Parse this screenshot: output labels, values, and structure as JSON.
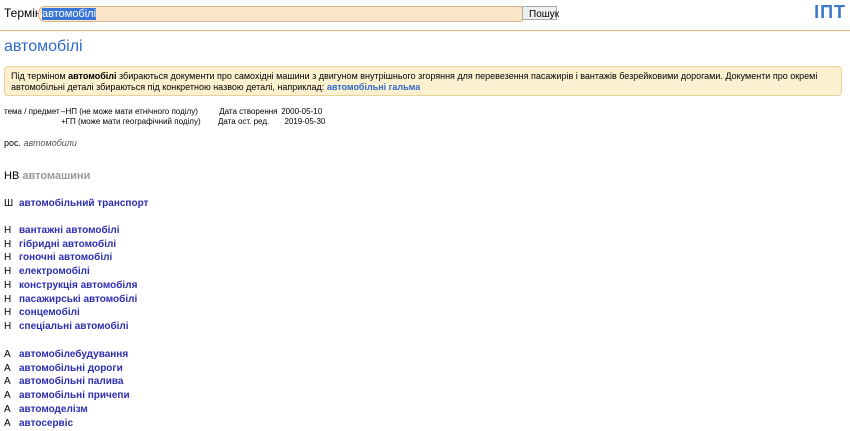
{
  "topbar": {
    "term_label": "Термін:",
    "term_value": "автомобілі",
    "search_button": "Пошук",
    "logo": "ІПТ"
  },
  "title": "автомобілі",
  "note": {
    "prefix": "Під терміном ",
    "term": "автомобілі",
    "text": " збираються документи про самохідні машини з двигуном внутрішнього згоряння для перевезення пасажирів і вантажів безрейковими дорогами. Документи про окремі автомобільні деталі збираються під конкретною назвою деталі, наприклад: ",
    "link": "автомобільні гальма"
  },
  "meta": {
    "label": "тема / предмет",
    "flag1": "–НП",
    "flag1_desc": "(не може мати етнічного поділу)",
    "flag2": "+ГП",
    "flag2_desc": "(може мати географічний поділу)",
    "created_label": "Дата створення",
    "created": "2000-05-10",
    "edited_label": "Дата ост. ред.",
    "edited": "2019-05-30"
  },
  "ros": {
    "label": "рос.",
    "value": "автомобили"
  },
  "nv": {
    "label": "НВ",
    "value": "автомашини"
  },
  "broader": [
    {
      "code": "Ш",
      "label": "автомобільний транспорт"
    }
  ],
  "narrower": [
    {
      "code": "Н",
      "label": "вантажні автомобілі"
    },
    {
      "code": "Н",
      "label": "гібридні автомобілі"
    },
    {
      "code": "Н",
      "label": "гоночні автомобілі"
    },
    {
      "code": "Н",
      "label": "електромобілі"
    },
    {
      "code": "Н",
      "label": "конструкція автомобіля"
    },
    {
      "code": "Н",
      "label": "пасажирські автомобілі"
    },
    {
      "code": "Н",
      "label": "сонцемобілі"
    },
    {
      "code": "Н",
      "label": "спеціальні автомобілі"
    }
  ],
  "associative": [
    {
      "code": "А",
      "label": "автомобілебудування"
    },
    {
      "code": "А",
      "label": "автомобільні дороги"
    },
    {
      "code": "А",
      "label": "автомобільні палива"
    },
    {
      "code": "А",
      "label": "автомобільні причепи"
    },
    {
      "code": "А",
      "label": "автомоделізм"
    },
    {
      "code": "А",
      "label": "автосервіс"
    }
  ]
}
